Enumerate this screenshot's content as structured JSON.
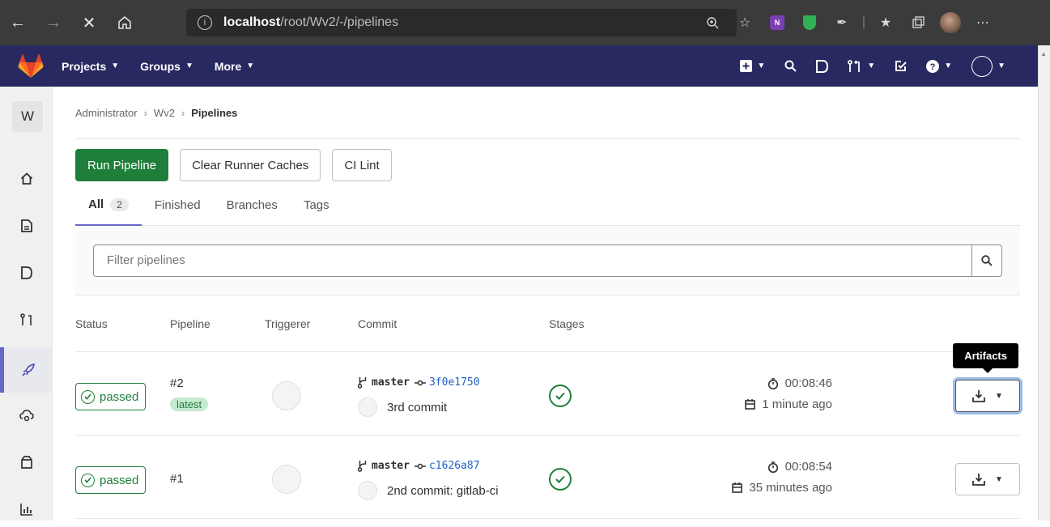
{
  "browser": {
    "url_host": "localhost",
    "url_path": "/root/Wv2/-/pipelines"
  },
  "header": {
    "nav": [
      {
        "label": "Projects"
      },
      {
        "label": "Groups"
      },
      {
        "label": "More"
      }
    ]
  },
  "sidebar": {
    "project_initial": "W"
  },
  "breadcrumb": {
    "items": [
      "Administrator",
      "Wv2",
      "Pipelines"
    ]
  },
  "actions": {
    "run_pipeline": "Run Pipeline",
    "clear_caches": "Clear Runner Caches",
    "ci_lint": "CI Lint"
  },
  "tabs": [
    {
      "label": "All",
      "count": "2"
    },
    {
      "label": "Finished"
    },
    {
      "label": "Branches"
    },
    {
      "label": "Tags"
    }
  ],
  "filter": {
    "placeholder": "Filter pipelines"
  },
  "table": {
    "headers": [
      "Status",
      "Pipeline",
      "Triggerer",
      "Commit",
      "Stages"
    ],
    "rows": [
      {
        "status": "passed",
        "pipeline_id": "#2",
        "badge": "latest",
        "branch": "master",
        "sha": "3f0e1750",
        "message": "3rd commit",
        "duration": "00:08:46",
        "finished": "1 minute ago"
      },
      {
        "status": "passed",
        "pipeline_id": "#1",
        "branch": "master",
        "sha": "c1626a87",
        "message": "2nd commit: gitlab-ci",
        "duration": "00:08:54",
        "finished": "35 minutes ago"
      }
    ]
  },
  "tooltip": {
    "text": "Artifacts"
  },
  "colors": {
    "header_bg": "#292961",
    "success": "#1f7f3a",
    "link": "#1f60c7",
    "tab_active": "#6666c4"
  }
}
